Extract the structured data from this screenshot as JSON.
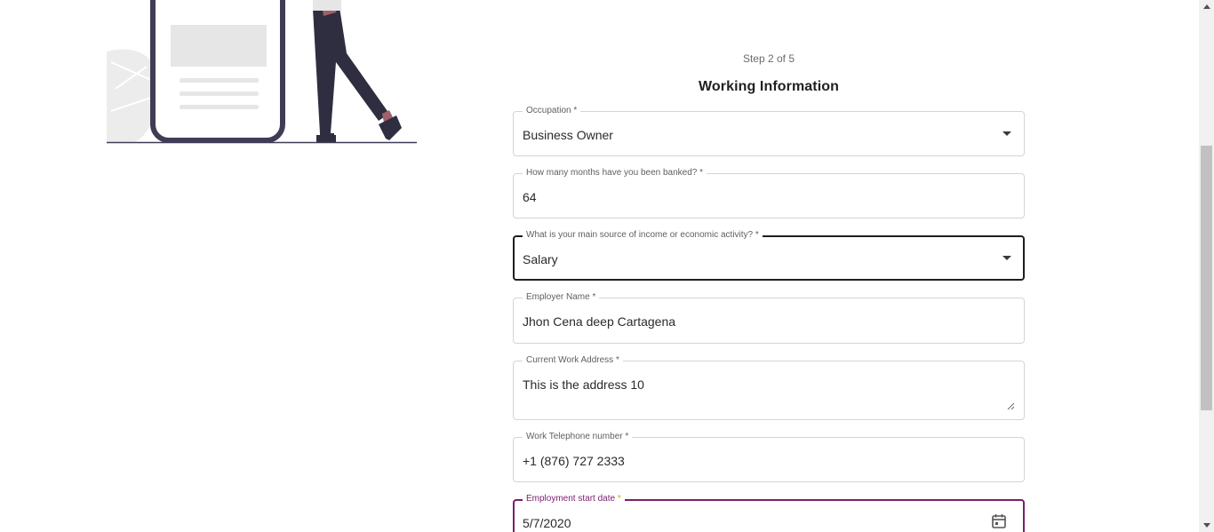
{
  "step": {
    "label": "Step 2 of 5"
  },
  "form": {
    "title": "Working Information",
    "occupation": {
      "label": "Occupation *",
      "value": "Business Owner"
    },
    "months_banked": {
      "label": "How many months have you been banked? *",
      "value": "64"
    },
    "income_source": {
      "label": "What is your main source of income or economic activity? *",
      "value": "Salary"
    },
    "employer_name": {
      "label": "Employer Name *",
      "value": "Jhon Cena deep Cartagena"
    },
    "work_address": {
      "label": "Current Work Address *",
      "value": "This is the address 10"
    },
    "work_phone": {
      "label": "Work Telephone number *",
      "value": "+1 (876) 727 2333"
    },
    "start_date": {
      "label": "Employment start date",
      "required_mark": "*",
      "value": "5/7/2020"
    }
  },
  "colors": {
    "accent": "#7b1e6b",
    "focus_dark": "#1f1f1f",
    "required_mark": "#e0a100",
    "illustration_dark": "#3f3d56",
    "illustration_skin": "#a0616a"
  },
  "icons": {
    "dropdown": "chevron-down-icon",
    "calendar": "calendar-icon",
    "resize": "resize-handle-icon"
  }
}
